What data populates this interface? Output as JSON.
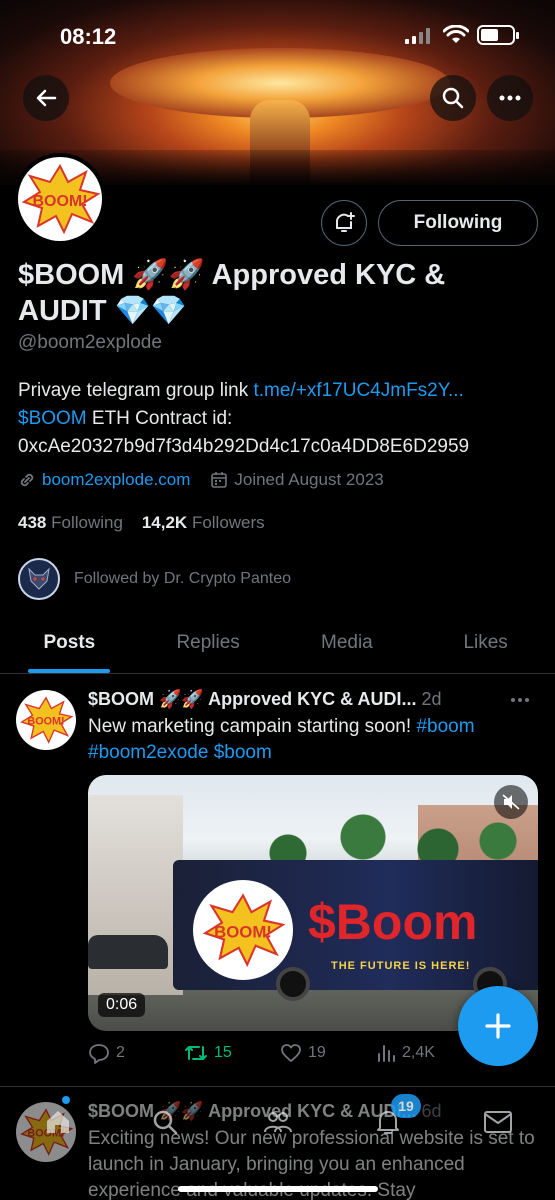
{
  "status_bar": {
    "time": "08:12"
  },
  "profile": {
    "name": "$BOOM 🚀🚀 Approved KYC & AUDIT 💎💎",
    "handle": "@boom2explode",
    "follow_button": "Following",
    "bio": {
      "line1_text": "Privaye telegram group link ",
      "line1_link": "t.me/+xf17UC4JmFs2Y...",
      "line2_link": "$BOOM",
      "line2_text": " ETH Contract id:",
      "line3_text": "0xcAe20327b9d7f3d4b292Dd4c17c0a4DD8E6D2959"
    },
    "website": "boom2explode.com",
    "joined": "Joined August 2023",
    "following_count": "438",
    "following_label": "Following",
    "followers_count": "14,2K",
    "followers_label": "Followers",
    "followed_by": "Followed by Dr. Crypto Panteo",
    "avatar_text": "BOOM!"
  },
  "tabs": [
    "Posts",
    "Replies",
    "Media",
    "Likes"
  ],
  "posts": [
    {
      "name": "$BOOM 🚀🚀 Approved KYC & AUDI...",
      "ago": "2d",
      "text_plain": "New marketing campain starting soon! ",
      "text_tag1": "#boom",
      "text_tag2": "#boom2exode",
      "text_tag3": "$boom",
      "video_duration": "0:06",
      "bus_text": "$Boom",
      "bus_tagline": "THE FUTURE IS HERE!",
      "replies": "2",
      "reposts": "15",
      "likes": "19",
      "views": "2,4K"
    },
    {
      "name": "$BOOM 🚀🚀 Approved KYC & AUDI...",
      "ago": "6d",
      "text": "Exciting news! Our new professional website is set to launch in January, bringing you an enhanced experience and valuable updates. Stay"
    }
  ],
  "bottom_nav": {
    "notifications_badge": "19"
  },
  "colors": {
    "accent": "#1d9bf0",
    "retweet": "#00ba7c",
    "muted": "#71767b",
    "background": "#000000"
  }
}
